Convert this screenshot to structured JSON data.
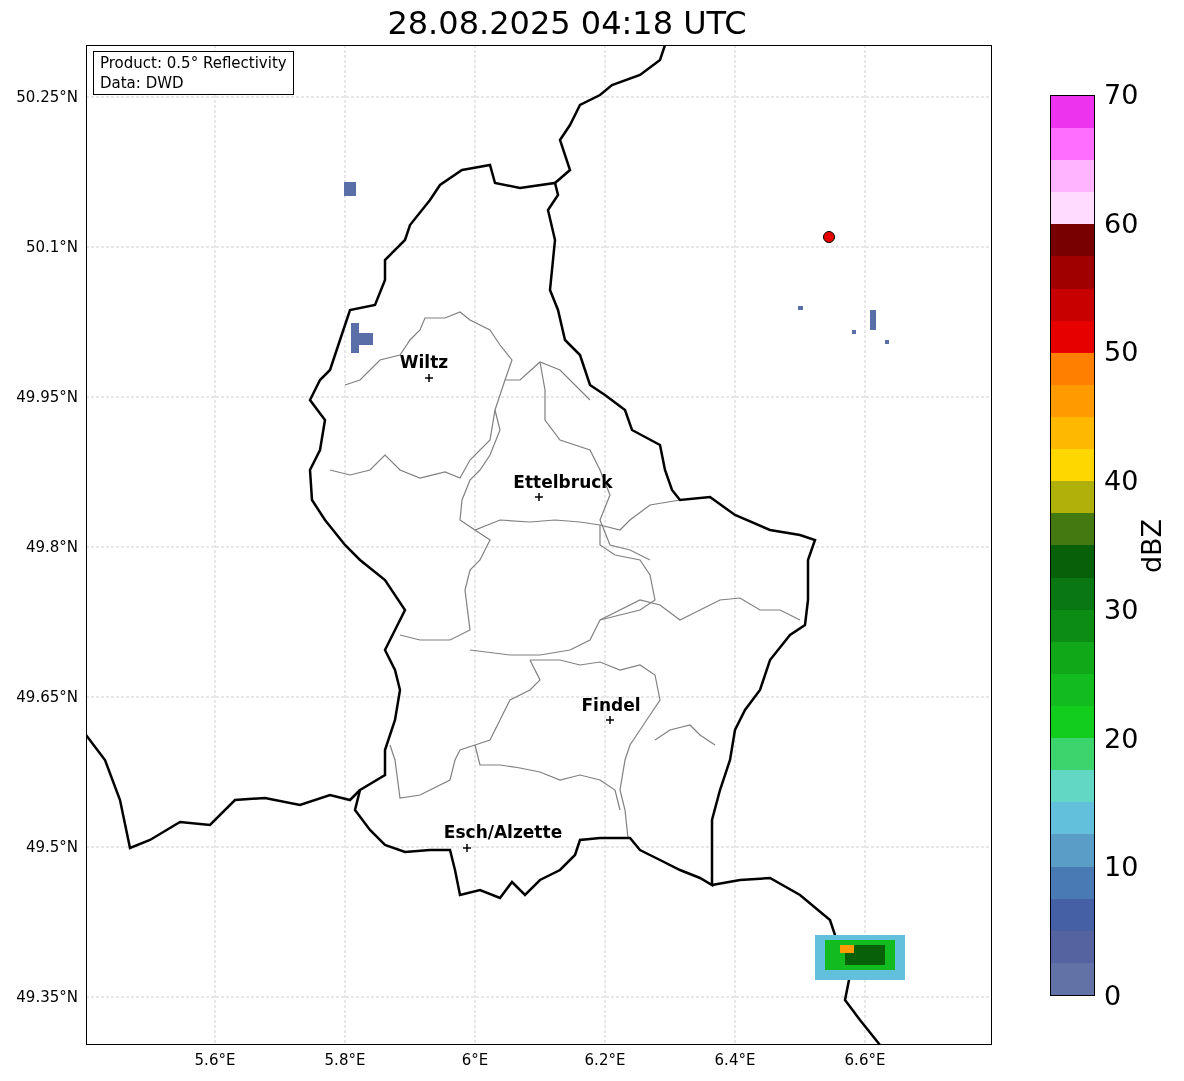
{
  "title": "28.08.2025 04:18 UTC",
  "map": {
    "info_box": [
      "Product: 0.5° Reflectivity",
      "Data: DWD"
    ],
    "cities": [
      {
        "name": "Wiltz"
      },
      {
        "name": "Ettelbruck"
      },
      {
        "name": "Findel"
      },
      {
        "name": "Esch/Alzette"
      }
    ],
    "y_ticks": [
      "50.25°N",
      "50.1°N",
      "49.95°N",
      "49.8°N",
      "49.65°N",
      "49.5°N",
      "49.35°N"
    ],
    "x_ticks": [
      "5.6°E",
      "5.8°E",
      "6°E",
      "6.2°E",
      "6.4°E",
      "6.6°E"
    ]
  },
  "colorbar": {
    "label": "dBZ",
    "ticks": [
      "70",
      "60",
      "50",
      "40",
      "30",
      "20",
      "10",
      "0"
    ],
    "colors": [
      {
        "color": "#6272a6"
      },
      {
        "color": "#5564a0"
      },
      {
        "color": "#4560a4"
      },
      {
        "color": "#4a7ab4"
      },
      {
        "color": "#5a9ec8"
      },
      {
        "color": "#62c0dc"
      },
      {
        "color": "#62d8c4"
      },
      {
        "color": "#3cd46c"
      },
      {
        "color": "#12cc1e"
      },
      {
        "color": "#12bc1e"
      },
      {
        "color": "#10a818"
      },
      {
        "color": "#0c8c14"
      },
      {
        "color": "#0a7812"
      },
      {
        "color": "#086008"
      },
      {
        "color": "#447810"
      },
      {
        "color": "#b0b00a"
      },
      {
        "color": "#ffd700"
      },
      {
        "color": "#ffb800"
      },
      {
        "color": "#ff9b00"
      },
      {
        "color": "#ff7f00"
      },
      {
        "color": "#e60000"
      },
      {
        "color": "#c80000"
      },
      {
        "color": "#a00000"
      },
      {
        "color": "#780000"
      },
      {
        "color": "#ffdcff"
      },
      {
        "color": "#ffb4ff"
      },
      {
        "color": "#ff6eff"
      },
      {
        "color": "#ee33ee"
      }
    ]
  }
}
